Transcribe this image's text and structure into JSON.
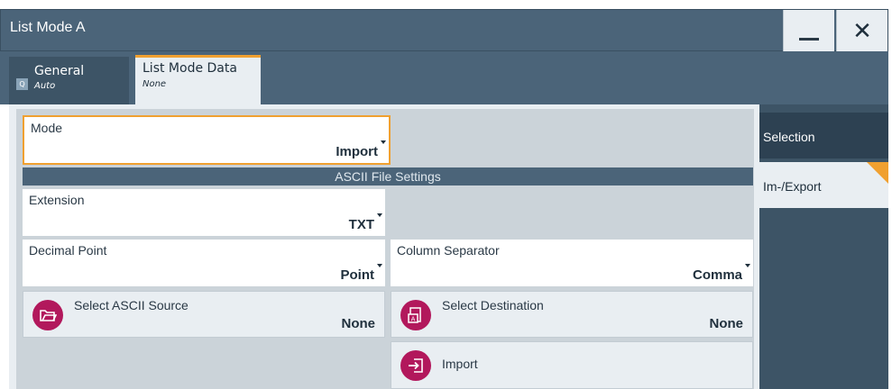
{
  "window": {
    "title": "List Mode A"
  },
  "tabs": [
    {
      "label": "General",
      "sublabel": "Auto"
    },
    {
      "label": "List Mode Data",
      "sublabel": "None"
    }
  ],
  "mode": {
    "label": "Mode",
    "value": "Import"
  },
  "section": {
    "title": "ASCII File Settings"
  },
  "extension": {
    "label": "Extension",
    "value": "TXT"
  },
  "decimal_point": {
    "label": "Decimal Point",
    "value": "Point"
  },
  "column_separator": {
    "label": "Column Separator",
    "value": "Comma"
  },
  "select_source": {
    "label": "Select ASCII Source",
    "value": "None"
  },
  "select_destination": {
    "label": "Select Destination",
    "value": "None"
  },
  "import_button": {
    "label": "Import"
  },
  "side_tabs": [
    {
      "label": "Selection"
    },
    {
      "label": "Im-/Export"
    }
  ],
  "colors": {
    "accent": "#f0a030",
    "titlebar": "#4b6479",
    "icon_bg": "#b2185c",
    "panel_dark": "#2d4152"
  }
}
